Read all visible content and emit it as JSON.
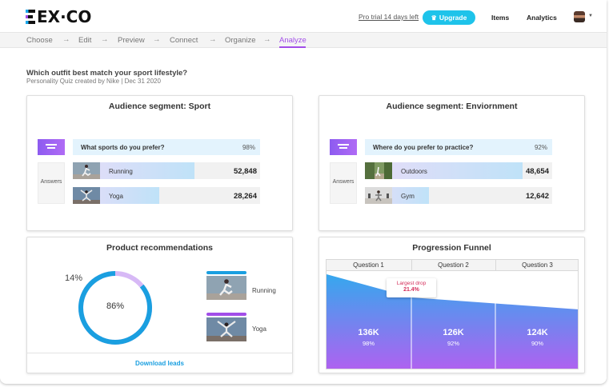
{
  "brand": {
    "logo_text": "EX·CO"
  },
  "header": {
    "pro_trial": "Pro trial 14 days left",
    "upgrade_label": "Upgrade",
    "nav_items": "Items",
    "nav_analytics": "Analytics"
  },
  "steps": {
    "items": [
      "Choose",
      "Edit",
      "Preview",
      "Connect",
      "Organize",
      "Analyze"
    ],
    "active": "Analyze",
    "arrow": "→"
  },
  "quiz": {
    "title": "Which outfit best match your sport lifestyle?",
    "subtitle": "Personality Quiz created by Nike | Dec 31 2020"
  },
  "segment_sport": {
    "title": "Audience segment: Sport",
    "question": "What sports do you prefer?",
    "question_pct": "98%",
    "answers_label": "Answers",
    "answers": [
      {
        "label": "Running",
        "value": "52,848",
        "share": 0.65
      },
      {
        "label": "Yoga",
        "value": "28,264",
        "share": 0.46
      }
    ]
  },
  "segment_env": {
    "title": "Audience segment: Enviornment",
    "question": "Where do you prefer to practice?",
    "question_pct": "92%",
    "answers_label": "Answers",
    "answers": [
      {
        "label": "Outdoors",
        "value": "48,654",
        "share": 0.84
      },
      {
        "label": "Gym",
        "value": "12,642",
        "share": 0.34
      }
    ]
  },
  "product_recs": {
    "title": "Product recommendations",
    "pct_small": "14%",
    "pct_large": "86%",
    "share_large": 0.86,
    "items": [
      {
        "label": "Running",
        "color": "#1a9fe0"
      },
      {
        "label": "Yoga",
        "color": "#a24ee8"
      }
    ],
    "download_label": "Download leads"
  },
  "funnel": {
    "title": "Progression Funnel",
    "tooltip_label": "Largest drop",
    "tooltip_value": "21.4%",
    "stages": [
      {
        "name": "Question 1",
        "count": "136K",
        "pct": "98%"
      },
      {
        "name": "Question 2",
        "count": "126K",
        "pct": "92%"
      },
      {
        "name": "Question 3",
        "count": "124K",
        "pct": "90%"
      }
    ]
  },
  "colors": {
    "accent": "#a24ee8",
    "blue": "#1ec3ea",
    "link": "#1a9fe0",
    "drop": "#d42f5b"
  }
}
